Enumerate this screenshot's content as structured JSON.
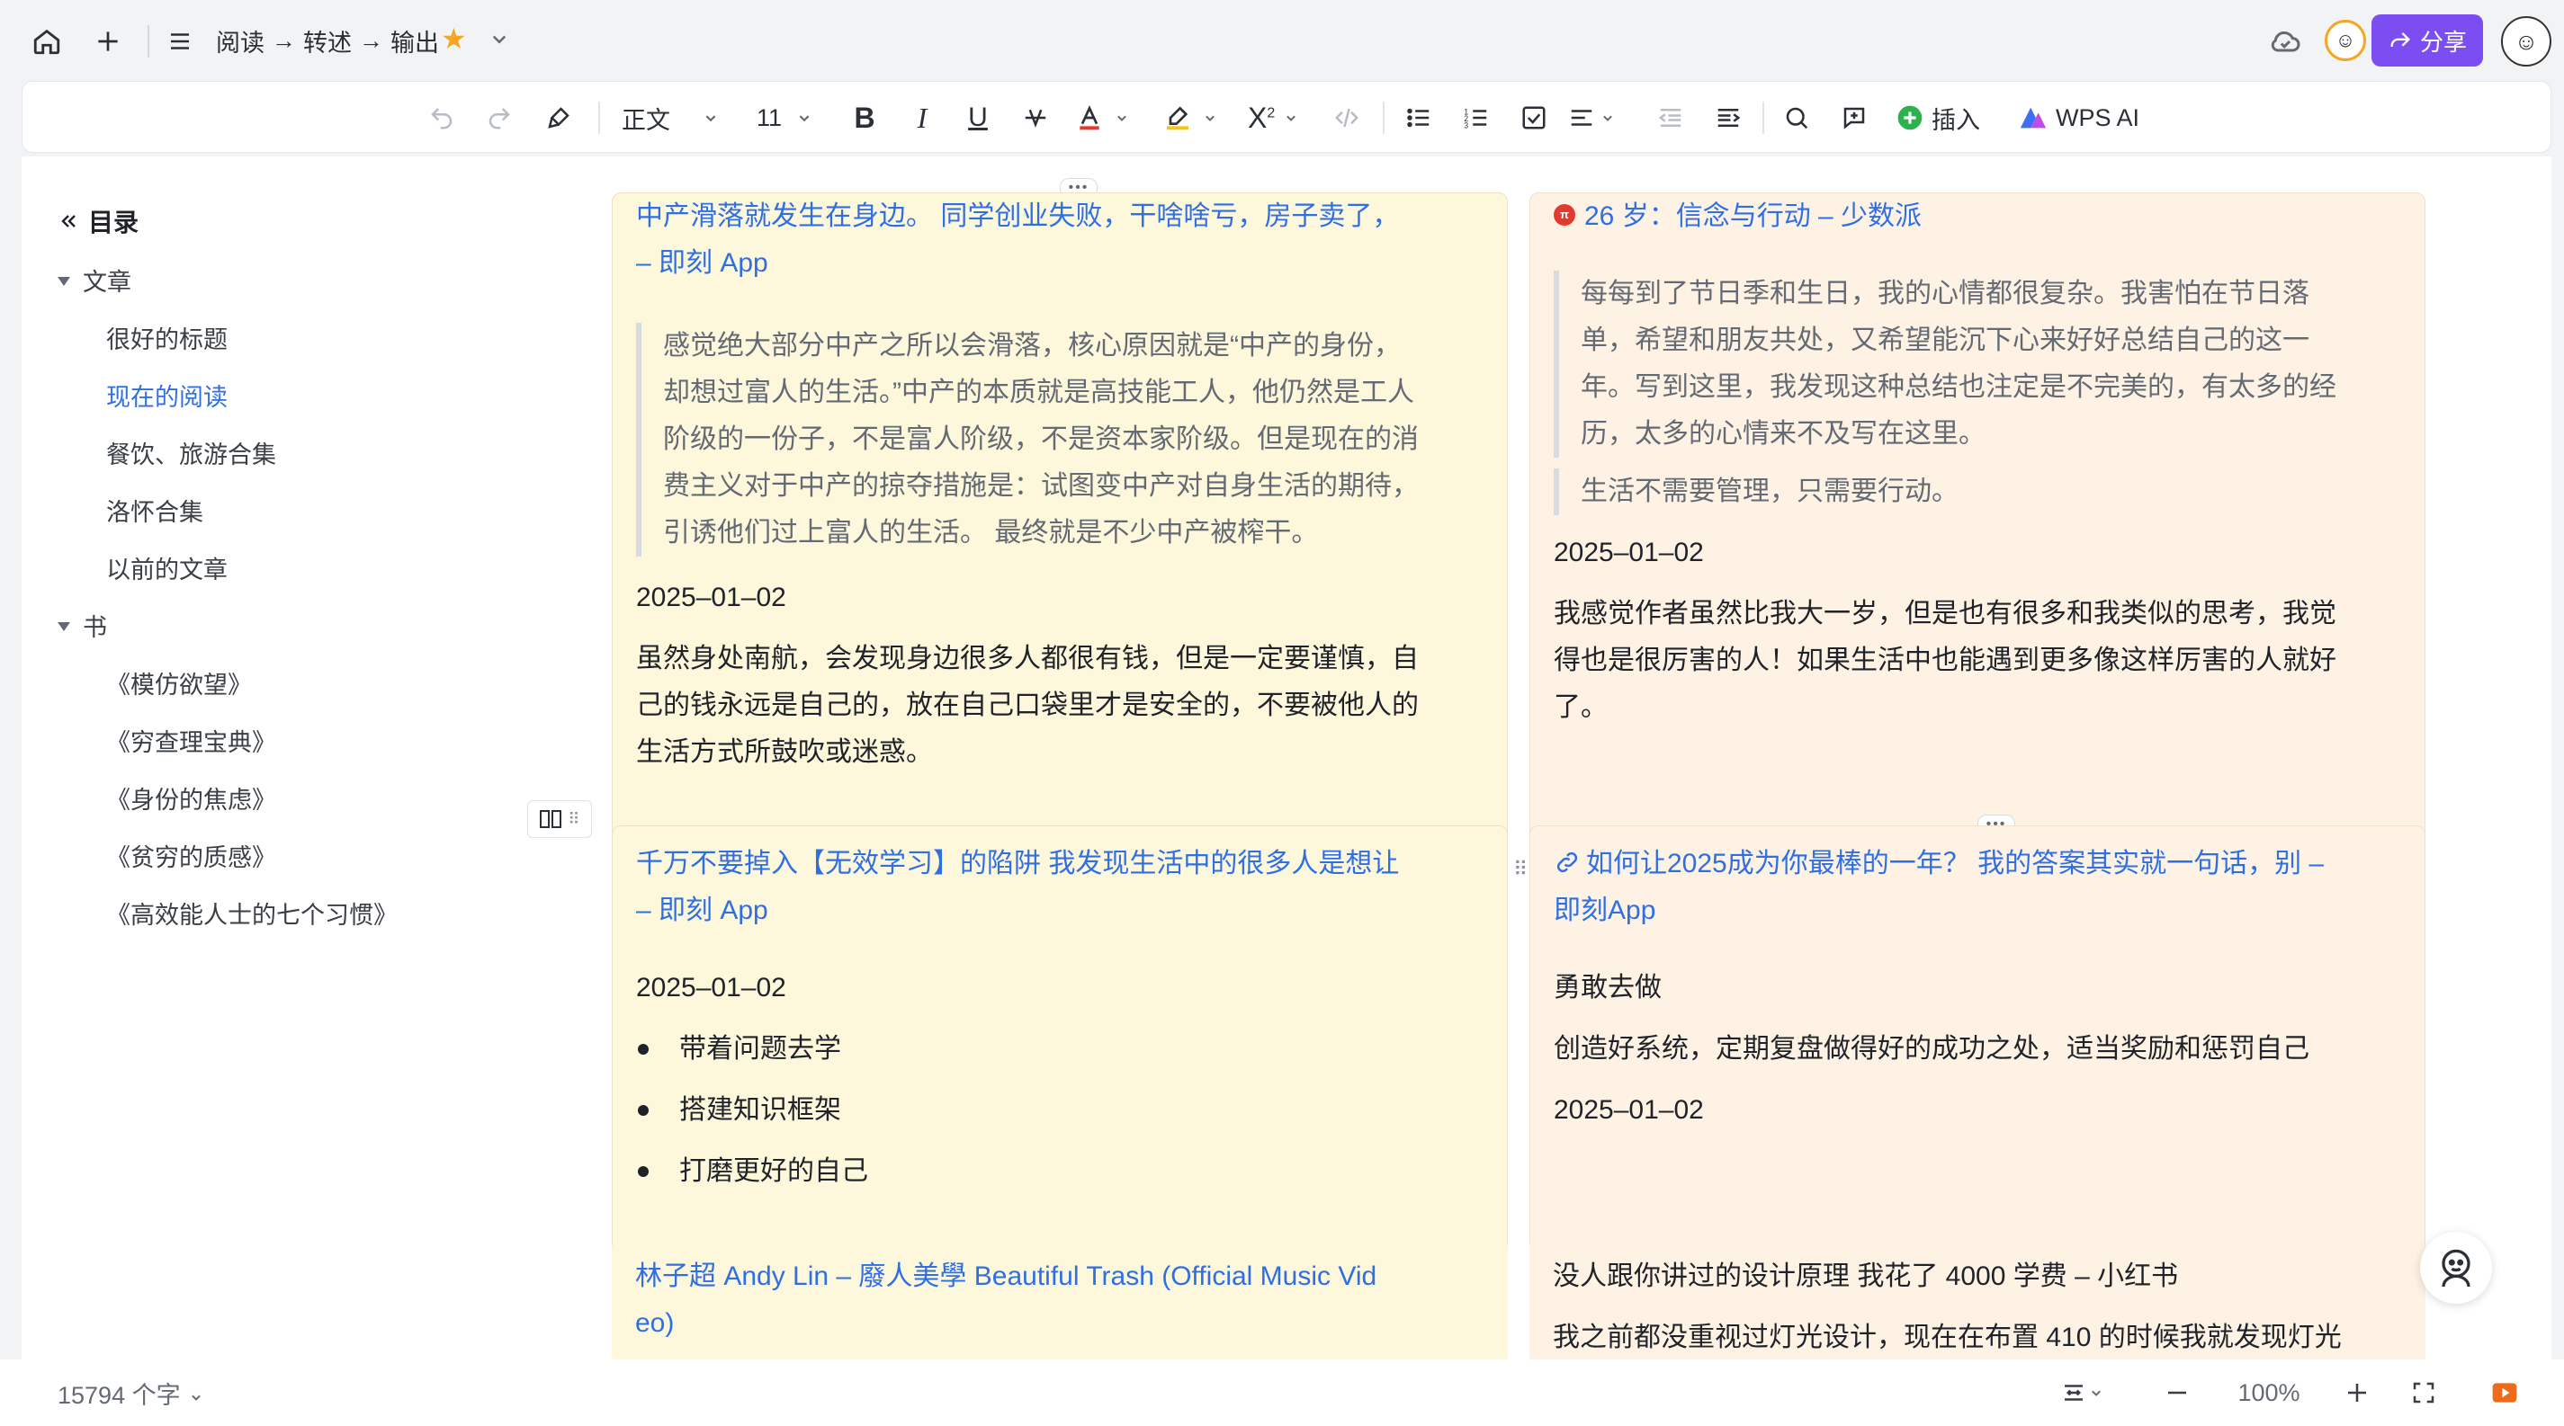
{
  "breadcrumb": [
    "阅读",
    "→",
    "转述",
    "→",
    "输出"
  ],
  "share_label": "分享",
  "toolbar": {
    "style_label": "正文",
    "font_size": "11",
    "insert_label": "插入",
    "ai_label": "WPS AI"
  },
  "toc": {
    "title": "目录",
    "groups": [
      {
        "label": "文章",
        "items": [
          "很好的标题",
          "现在的阅读",
          "餐饮、旅游合集",
          "洛怀合集",
          "以前的文章"
        ]
      },
      {
        "label": "书",
        "items": [
          "《模仿欲望》",
          "《穷查理宝典》",
          "《身份的焦虑》",
          "《贫穷的质感》",
          "《高效能人士的七个习惯》"
        ]
      }
    ],
    "active_item": "现在的阅读"
  },
  "cards": {
    "c1": {
      "link": [
        "中产滑落就发生在身边。 同学创业失败，干啥啥亏，房子卖了，",
        "– 即刻 App"
      ],
      "quote": [
        "感觉绝大部分中产之所以会滑落，核心原因就是“中产的身份，",
        "却想过富人的生活。”中产的本质就是高技能工人，他仍然是工人",
        "阶级的一份子，不是富人阶级，不是资本家阶级。但是现在的消",
        "费主义对于中产的掠夺措施是：试图变中产对自身生活的期待，",
        "引诱他们过上富人的生活。 最终就是不少中产被榨干。"
      ],
      "date": "2025–01–02",
      "body": [
        "虽然身处南航，会发现身边很多人都很有钱，但是一定要谨慎，自",
        "己的钱永远是自己的，放在自己口袋里才是安全的，不要被他人的",
        "生活方式所鼓吹或迷惑。"
      ]
    },
    "c2": {
      "link": "26 岁：信念与行动 – 少数派",
      "quote1": [
        "每每到了节日季和生日，我的心情都很复杂。我害怕在节日落",
        "单，希望和朋友共处，又希望能沉下心来好好总结自己的这一",
        "年。写到这里，我发现这种总结也注定是不完美的，有太多的经",
        "历，太多的心情来不及写在这里。"
      ],
      "quote2": "生活不需要管理，只需要行动。",
      "date": "2025–01–02",
      "body": [
        "我感觉作者虽然比我大一岁，但是也有很多和我类似的思考，我觉",
        "得也是很厉害的人！如果生活中也能遇到更多像这样厉害的人就好",
        "了。"
      ]
    },
    "c3": {
      "link": [
        "千万不要掉入【无效学习】的陷阱  我发现生活中的很多人是想让",
        "– 即刻 App"
      ],
      "date": "2025–01–02",
      "bullets": [
        "带着问题去学",
        "搭建知识框架",
        "打磨更好的自己"
      ]
    },
    "c4": {
      "link": [
        "如何让2025成为你最棒的一年？ 我的答案其实就一句话，别 –",
        "即刻App"
      ],
      "line1": "勇敢去做",
      "line2": "创造好系统，定期复盘做得好的成功之处，适当奖励和惩罚自己",
      "date": "2025–01–02"
    },
    "c5": {
      "link": [
        "林子超 Andy Lin – 廢人美學 Beautiful Trash (Official Music Vid",
        "eo)"
      ]
    },
    "c6": {
      "title": "没人跟你讲过的设计原理 我花了 4000 学费 – 小红书",
      "body": "我之前都没重视过灯光设计，现在在布置 410 的时候我就发现灯光"
    }
  },
  "status": {
    "word_count": "15794 个字",
    "zoom": "100%"
  },
  "colors": {
    "accent": "#2f6fe4",
    "share": "#7c4df1",
    "star": "#f5a623"
  }
}
